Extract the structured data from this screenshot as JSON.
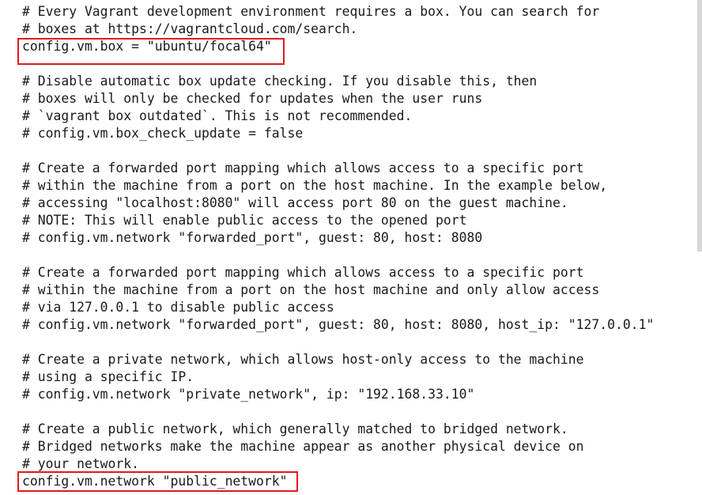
{
  "code_lines": [
    "# Every Vagrant development environment requires a box. You can search for",
    "# boxes at https://vagrantcloud.com/search.",
    "config.vm.box = \"ubuntu/focal64\"",
    "",
    "# Disable automatic box update checking. If you disable this, then",
    "# boxes will only be checked for updates when the user runs",
    "# `vagrant box outdated`. This is not recommended.",
    "# config.vm.box_check_update = false",
    "",
    "# Create a forwarded port mapping which allows access to a specific port",
    "# within the machine from a port on the host machine. In the example below,",
    "# accessing \"localhost:8080\" will access port 80 on the guest machine.",
    "# NOTE: This will enable public access to the opened port",
    "# config.vm.network \"forwarded_port\", guest: 80, host: 8080",
    "",
    "# Create a forwarded port mapping which allows access to a specific port",
    "# within the machine from a port on the host machine and only allow access",
    "# via 127.0.0.1 to disable public access",
    "# config.vm.network \"forwarded_port\", guest: 80, host: 8080, host_ip: \"127.0.0.1\"",
    "",
    "# Create a private network, which allows host-only access to the machine",
    "# using a specific IP.",
    "# config.vm.network \"private_network\", ip: \"192.168.33.10\"",
    "",
    "# Create a public network, which generally matched to bridged network.",
    "# Bridged networks make the machine appear as another physical device on",
    "# your network.",
    "config.vm.network \"public_network\""
  ],
  "highlight_color": "#e0191e",
  "text_color": "#1a1a1a",
  "background_color": "#ffffff"
}
